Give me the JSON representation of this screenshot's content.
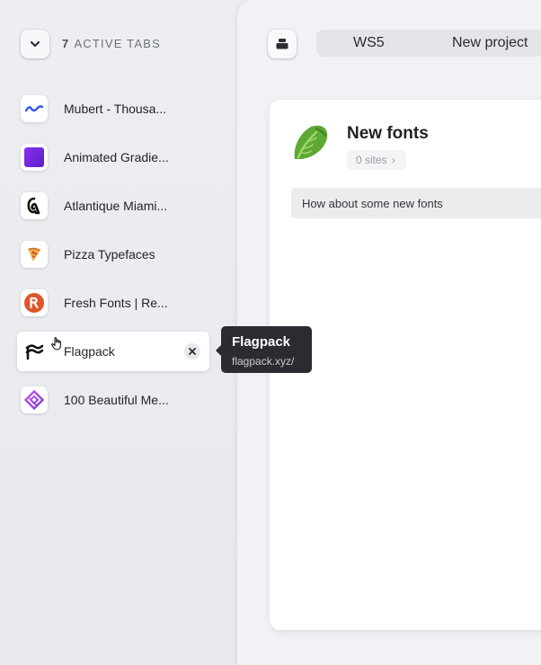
{
  "sidebar": {
    "active_count": "7",
    "active_label": "ACTIVE TABS",
    "tabs": [
      {
        "title": "Mubert - Thousa...",
        "icon": "mubert-icon"
      },
      {
        "title": "Animated Gradie...",
        "icon": "gradient-square-icon"
      },
      {
        "title": "Atlantique Miami...",
        "icon": "atlantique-logo-icon"
      },
      {
        "title": "Pizza Typefaces",
        "icon": "pizza-slice-icon"
      },
      {
        "title": "Fresh Fonts | Re...",
        "icon": "fresh-fonts-r-icon"
      },
      {
        "title": "Flagpack",
        "icon": "flagpack-icon",
        "active": true
      },
      {
        "title": "100 Beautiful Me...",
        "icon": "diamond-logo-icon"
      }
    ]
  },
  "tooltip": {
    "title": "Flagpack",
    "url": "flagpack.xyz/"
  },
  "header": {
    "workspace": "WS5",
    "project": "New project"
  },
  "card": {
    "title": "New fonts",
    "icon": "lettuce-icon",
    "sites": "0 sites",
    "description": "How about some new fonts"
  },
  "colors": {
    "accent_purple": "#6d28d9",
    "tooltip_bg": "#2a2c32",
    "mubert_blue": "#2f54eb",
    "fresh_fonts_orange": "#e0552b"
  }
}
